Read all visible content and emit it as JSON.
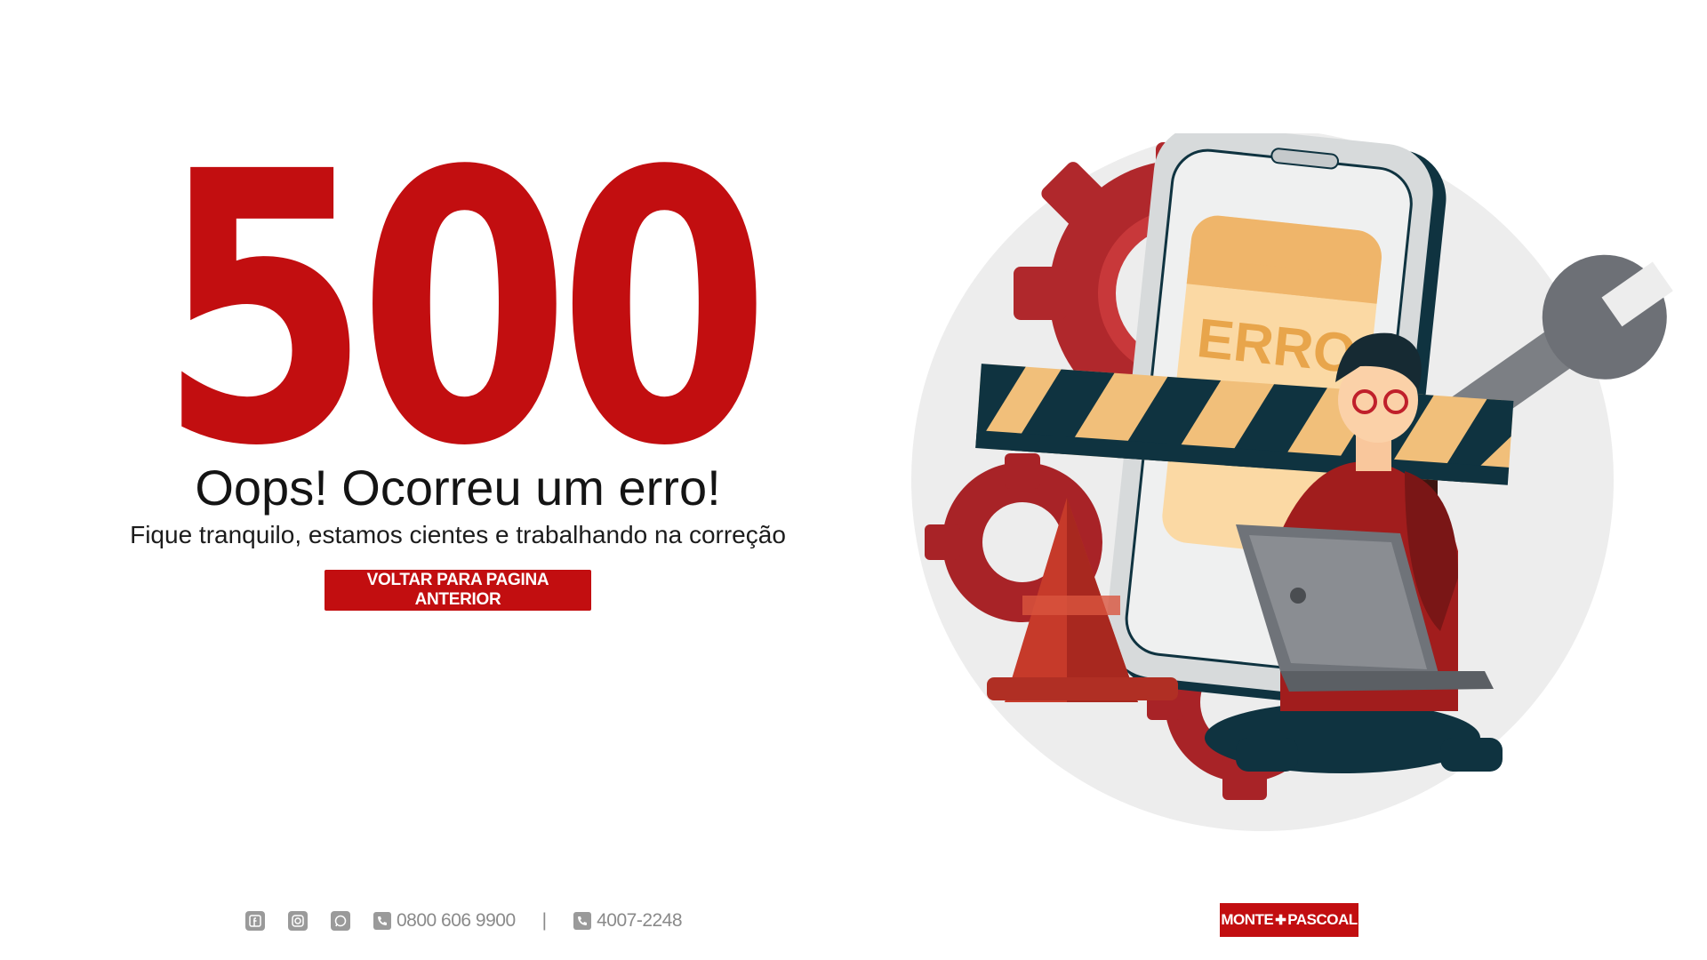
{
  "error": {
    "code": "500",
    "title": "Oops! Ocorreu um erro!",
    "message": "Fique tranquilo, estamos cientes e trabalhando na correção",
    "back_button_label": "VOLTAR PARA PAGINA ANTERIOR"
  },
  "illustration": {
    "screen_text": "ERRO"
  },
  "footer": {
    "social": [
      {
        "icon": "facebook-icon"
      },
      {
        "icon": "instagram-icon"
      },
      {
        "icon": "whatsapp-icon"
      }
    ],
    "phone_1": "0800 606 9900",
    "separator": "|",
    "phone_2": "4007-2248",
    "logo_left": "MONTE",
    "logo_symbol": "✚",
    "logo_right": "PASCOAL"
  },
  "colors": {
    "brand_red": "#c20e10",
    "text_dark": "#141414",
    "footer_gray": "#8a8a8a"
  }
}
